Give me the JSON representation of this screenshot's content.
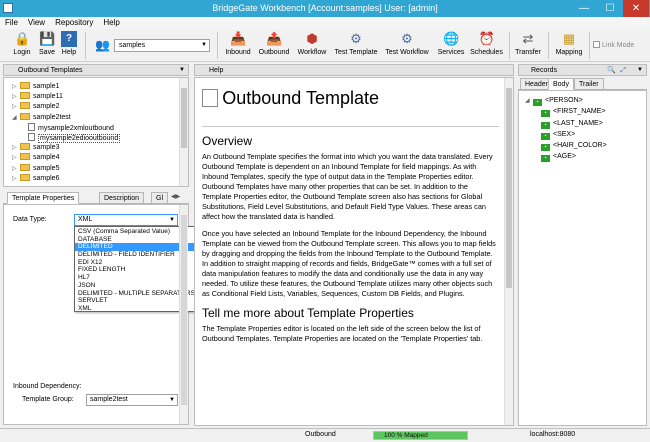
{
  "window": {
    "title": "BridgeGate Workbench [Account:samples] User: [admin]",
    "minimize": "—",
    "maximize": "☐",
    "close": "✕"
  },
  "menu": [
    "File",
    "View",
    "Repository",
    "Help"
  ],
  "toolbar": {
    "login": "Login",
    "save": "Save",
    "help": "Help",
    "account_value": "samples",
    "inbound": "Inbound",
    "outbound": "Outbound",
    "workflow": "Workflow",
    "test_template": "Test Template",
    "test_workflow": "Test Workflow",
    "services": "Services",
    "schedules": "Schedules",
    "transfer": "Transfer",
    "mapping": "Mapping",
    "link_mode": "Link Mode"
  },
  "left": {
    "header": "Outbound Templates",
    "tree": [
      {
        "label": "sample1",
        "type": "folder",
        "level": 0
      },
      {
        "label": "sample11",
        "type": "folder",
        "level": 0
      },
      {
        "label": "sample2",
        "type": "folder",
        "level": 0
      },
      {
        "label": "sample2test",
        "type": "folder",
        "level": 0,
        "expanded": true
      },
      {
        "label": "mysample2xmloutbound",
        "type": "doc",
        "level": 1
      },
      {
        "label": "mysample2ediooutbound",
        "type": "doc",
        "level": 1
      },
      {
        "label": "sample3",
        "type": "folder",
        "level": 0
      },
      {
        "label": "sample4",
        "type": "folder",
        "level": 0
      },
      {
        "label": "sample5",
        "type": "folder",
        "level": 0
      },
      {
        "label": "sample6",
        "type": "folder",
        "level": 0
      }
    ],
    "tabs": [
      "Template Properties",
      "Description",
      "Gl"
    ],
    "data_type_label": "Data Type:",
    "data_type_value": "XML",
    "options": [
      "CSV (Comma Separated Value)",
      "DATABASE",
      "DELIMITED",
      "DELIMITED - FIELD IDENTIFIER",
      "EDI X12",
      "FIXED LENGTH",
      "HL7",
      "JSON",
      "DELIMITED - MULTIPLE SEPARATORS",
      "SERVLET",
      "XML"
    ],
    "selected_option_index": 2,
    "inbound_dependency": "Inbound Dependency:",
    "template_group_label": "Template Group:",
    "template_group_value": "sample2test"
  },
  "help": {
    "header": "Help",
    "title": "Outbound Template",
    "overview": "Overview",
    "p1": "An Outbound Template specifies the format into which you want the data translated. Every Outbound Template is dependent on an Inbound Template for field mappings. As with Inbound Templates, specify the type of output data in the Template Properties editor. Outbound Templates have many other properties that can be set. In addition to the Template Properties editor, the Outbound Template screen also has sections for Global Substitutions, Field Level Substitutions, and Default Field Type Values. These areas can affect how the translated data is handled.",
    "p2": "Once you have selected an Inbound Template for the Inbound Dependency, the Inbound Template can be viewed from the Outbound Template screen. This allows you to map fields by dragging and dropping the fields from the Inbound Template to the Outbound Template. In addition to straight mapping of records and fields, BridgeGate™ comes with a full set of data manipulation features to modify the data and conditionally use the data in any way needed. To utilize these features, the Outbound Template utilizes many other objects such as Conditional Field Lists, Variables, Sequences, Custom DB Fields, and Plugins.",
    "more": "Tell me more about Template Properties",
    "p3": "The Template Properties editor is located on the left side of the screen below the list of Outbound Templates. Template Properties are located on the 'Template Properties' tab."
  },
  "records": {
    "header": "Records",
    "tabs": [
      "Header",
      "Body",
      "Trailer"
    ],
    "items": [
      "<PERSON>",
      "<FIRST_NAME>",
      "<LAST_NAME>",
      "<SEX>",
      "<HAIR_COLOR>",
      "<AGE>"
    ]
  },
  "status": {
    "mode": "Outbound",
    "progress_text": "100 %  Mapped",
    "progress": 1.0,
    "host": "localhost:8080"
  }
}
